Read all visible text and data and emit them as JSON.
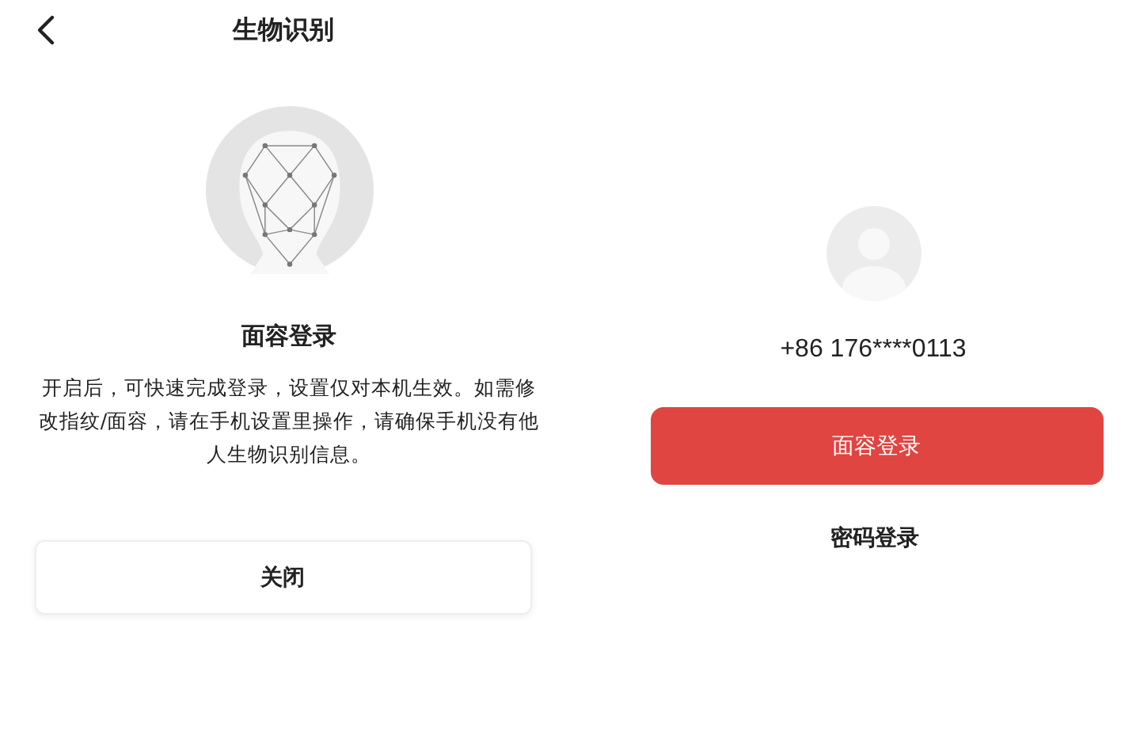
{
  "left": {
    "header": {
      "title": "生物识别"
    },
    "feature": {
      "title": "面容登录",
      "description": "开启后，可快速完成登录，设置仅对本机生效。如需修改指纹/面容，请在手机设置里操作，请确保手机没有他人生物识别信息。"
    },
    "close_button": "关闭"
  },
  "right": {
    "phone": "+86 176****0113",
    "primary_button": "面容登录",
    "secondary_link": "密码登录"
  }
}
